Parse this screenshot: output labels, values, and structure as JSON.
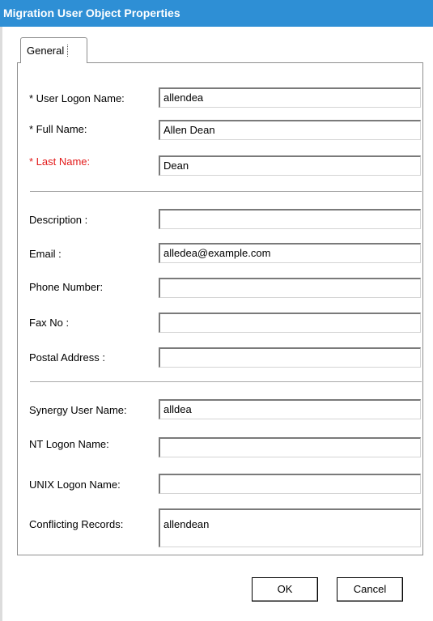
{
  "window": {
    "title": "Migration User Object Properties"
  },
  "tabs": [
    {
      "label": "General"
    }
  ],
  "identity": {
    "user_logon_name": {
      "label": "* User Logon Name:",
      "value": "allendea"
    },
    "full_name": {
      "label": "* Full Name:",
      "value": "Allen Dean"
    },
    "last_name": {
      "label": "* Last Name:",
      "value": "Dean"
    }
  },
  "contact": {
    "description": {
      "label": "Description :",
      "value": ""
    },
    "email": {
      "label": "Email :",
      "value": "alledea@example.com"
    },
    "phone_number": {
      "label": "Phone Number:",
      "value": ""
    },
    "fax_no": {
      "label": "Fax No :",
      "value": ""
    },
    "postal_address": {
      "label": "Postal Address :",
      "value": ""
    }
  },
  "accounts": {
    "synergy_user_name": {
      "label": "Synergy User Name:",
      "value": "alldea"
    },
    "nt_logon_name": {
      "label": "NT Logon Name:",
      "value": ""
    },
    "unix_logon_name": {
      "label": "UNIX Logon Name:",
      "value": ""
    },
    "conflicting_records": {
      "label": "Conflicting Records:",
      "value": "allendean"
    }
  },
  "buttons": {
    "ok": "OK",
    "cancel": "Cancel"
  },
  "colors": {
    "titlebar": "#2e8fd5",
    "required_highlight": "#e21a1a"
  }
}
